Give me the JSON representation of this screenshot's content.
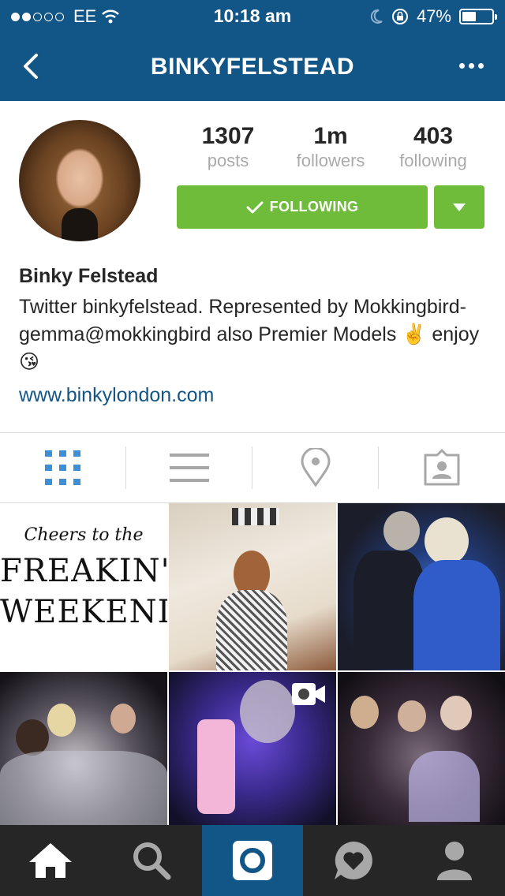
{
  "status_bar": {
    "carrier": "EE",
    "time": "10:18 am",
    "battery": "47%",
    "battery_level": 0.47
  },
  "nav": {
    "title": "BINKYFELSTEAD",
    "back_icon": "chevron-left-icon",
    "more_icon": "more-icon"
  },
  "profile": {
    "stats": [
      {
        "value": "1307",
        "label": "posts"
      },
      {
        "value": "1m",
        "label": "followers"
      },
      {
        "value": "403",
        "label": "following"
      }
    ],
    "follow_label": "FOLLOWING",
    "name": "Binky Felstead",
    "bio": "Twitter binkyfelstead. Represented by Mokkingbird- gemma@mokkingbird also Premier Models ✌️ enjoy 😘",
    "website": "www.binkylondon.com"
  },
  "tabs": [
    {
      "icon": "grid-icon",
      "active": true
    },
    {
      "icon": "list-icon",
      "active": false
    },
    {
      "icon": "location-icon",
      "active": false
    },
    {
      "icon": "tagged-icon",
      "active": false
    }
  ],
  "posts": {
    "first_post_text": [
      "Cheers to the",
      "FREAKIN'",
      "WEEKEND"
    ]
  },
  "bottom_nav": [
    {
      "icon": "home-icon"
    },
    {
      "icon": "search-icon"
    },
    {
      "icon": "camera-icon",
      "active": true
    },
    {
      "icon": "activity-icon"
    },
    {
      "icon": "profile-icon"
    }
  ],
  "colors": {
    "brand": "#125688",
    "follow_green": "#6fbb3a"
  }
}
